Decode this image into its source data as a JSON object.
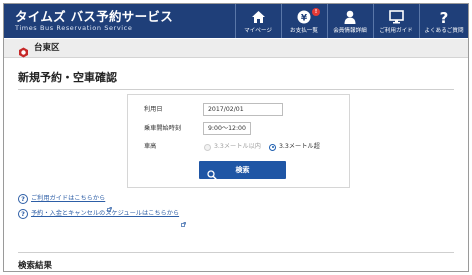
{
  "header": {
    "brand_title": "タイムズ バス予約サービス",
    "brand_subtitle": "Times Bus Reservation Service",
    "background": "#1f3f79",
    "nav": [
      {
        "label": "マイページ",
        "icon": "home-icon"
      },
      {
        "label": "お支払一覧",
        "icon": "yen-icon",
        "badge": "!"
      },
      {
        "label": "会員情報詳細",
        "icon": "person-icon"
      },
      {
        "label": "ご利用ガイド",
        "icon": "monitor-icon"
      },
      {
        "label": "よくあるご質問",
        "icon": "question-icon"
      }
    ]
  },
  "subbar": {
    "location": "台東区",
    "icon": "bus-stop-icon"
  },
  "page": {
    "title": "新規予約・空車確認"
  },
  "form": {
    "date_label": "利用日",
    "date_value": "2017/02/01",
    "time_label": "乗車開始時刻",
    "time_value": "9:00〜12:00",
    "vehicle_label": "車高",
    "vehicle_options": [
      {
        "label": "3.3メートル以内",
        "selected": false,
        "disabled": true
      },
      {
        "label": "3.3メートル超",
        "selected": true,
        "disabled": false
      }
    ],
    "search_label": "検索",
    "accent": "#1f56a5"
  },
  "links": [
    {
      "text": "ご利用ガイドはこちらから"
    },
    {
      "text": "予約・入金とキャンセルのスケジュールはこちらから"
    }
  ],
  "results": {
    "title": "検索結果"
  }
}
